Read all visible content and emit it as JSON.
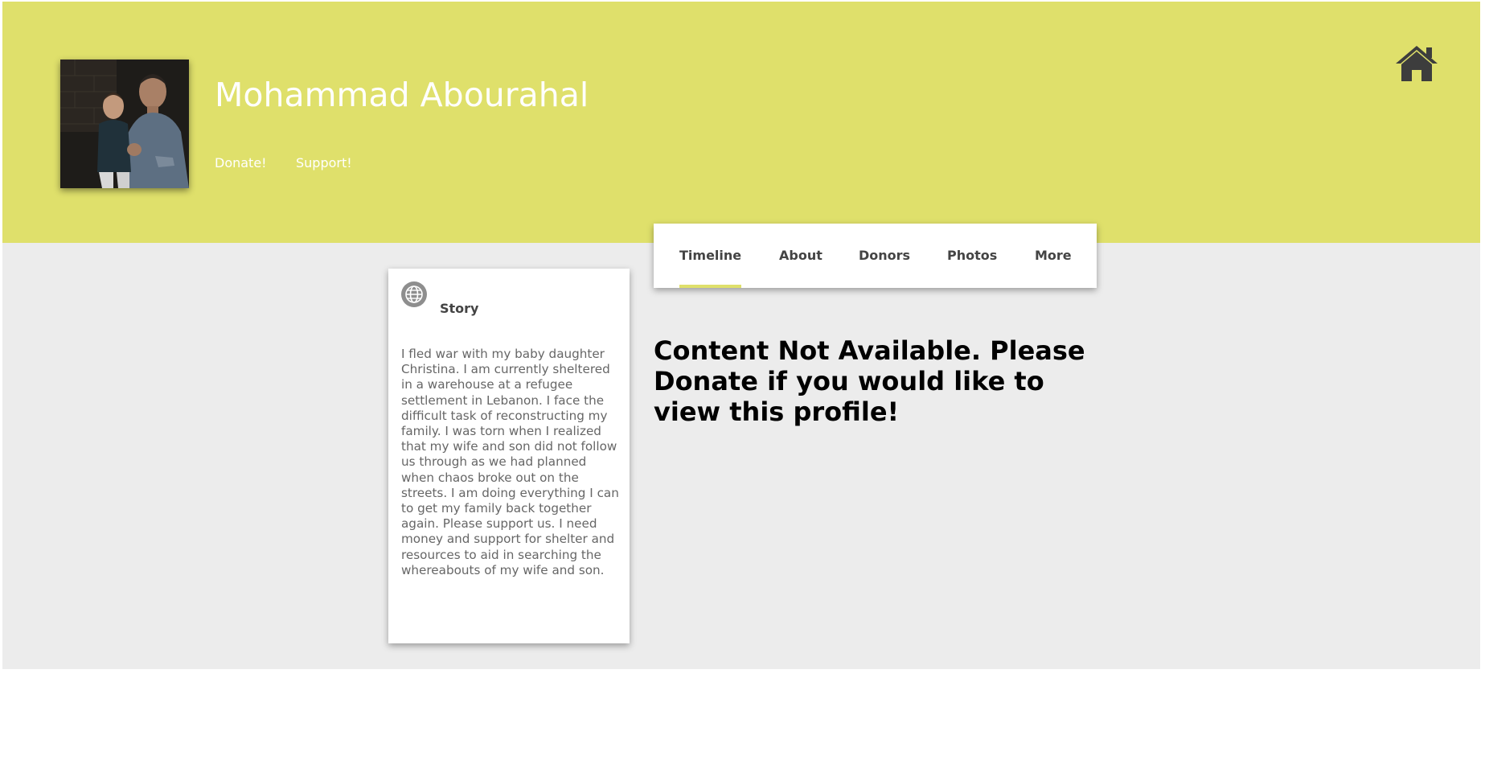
{
  "header": {
    "name": "Mohammad Abourahal",
    "links": {
      "donate": "Donate!",
      "support": "Support!"
    },
    "home_icon": "home-icon",
    "background_color": "#dfe06b"
  },
  "tabs": [
    {
      "label": "Timeline",
      "active": true
    },
    {
      "label": "About",
      "active": false
    },
    {
      "label": "Donors",
      "active": false
    },
    {
      "label": "Photos",
      "active": false
    },
    {
      "label": "More",
      "active": false
    }
  ],
  "story": {
    "icon": "globe-icon",
    "title": "Story",
    "text": "I fled war with my baby daughter Christina. I am currently sheltered in a warehouse at a refugee settlement in Lebanon. I face the difficult task of reconstructing my family. I was torn when I realized that my wife and son did not follow us through as we had planned when chaos broke out on the streets. I am doing everything I can to get my family back together again. Please support us. I need money and support for shelter and resources to aid in searching the whereabouts of my wife and son."
  },
  "notice": "Content Not Available. Please Donate if you would like to view this profile!",
  "colors": {
    "accent": "#dfe06b",
    "page_background": "#ececec",
    "tab_text": "#444444",
    "story_text": "#666666"
  }
}
